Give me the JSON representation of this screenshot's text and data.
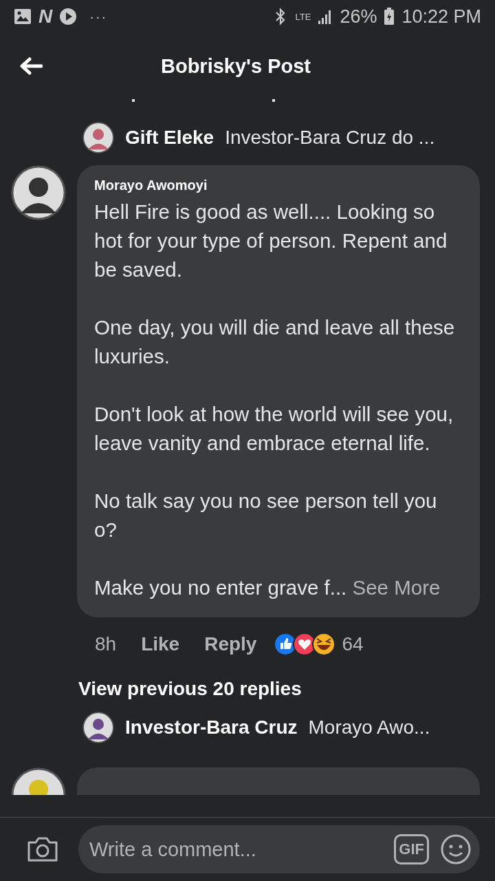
{
  "status_bar": {
    "app_letter": "N",
    "more": "···",
    "network": "LTE",
    "battery": "26%",
    "time": "10:22 PM"
  },
  "header": {
    "title": "Bobrisky's Post"
  },
  "replies_above": [
    {
      "author": "Gift Eleke",
      "text": "Investor-Bara Cruz do ..."
    }
  ],
  "comment": {
    "author": "Morayo Awomoyi",
    "paragraphs": [
      "Hell Fire is good as well.... Looking so hot for your type of person. Repent and be saved.",
      "One day, you will die and leave all these luxuries.",
      "Don't look at how the world will see you, leave vanity and embrace eternal life.",
      "No talk say you no see person tell you o?",
      "Make you no enter grave f..."
    ],
    "see_more": "See More",
    "time": "8h",
    "like": "Like",
    "reply": "Reply",
    "reaction_count": "64"
  },
  "view_previous": "View previous 20 replies",
  "replies_below": [
    {
      "author": "Investor-Bara Cruz",
      "text": "Morayo Awo..."
    }
  ],
  "composer": {
    "placeholder": "Write a comment...",
    "gif": "GIF"
  }
}
